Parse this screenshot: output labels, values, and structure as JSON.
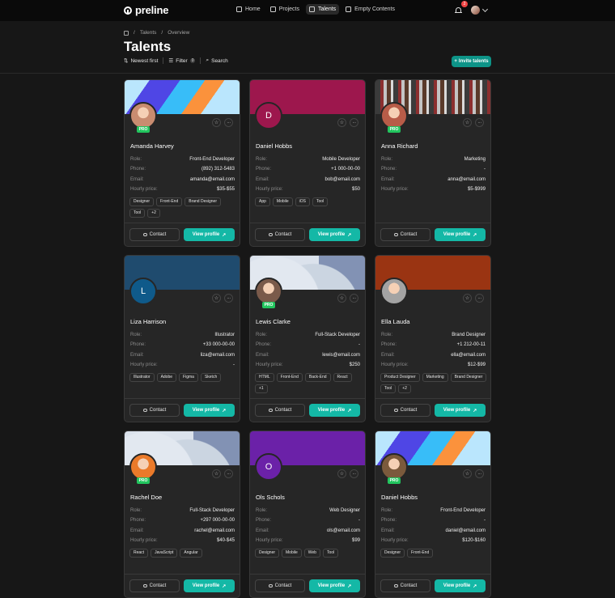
{
  "brand": {
    "name": "preline"
  },
  "nav": [
    {
      "label": "Home",
      "icon": "home-icon",
      "active": false
    },
    {
      "label": "Projects",
      "icon": "briefcase-icon",
      "active": false
    },
    {
      "label": "Talents",
      "icon": "users-icon",
      "active": true
    },
    {
      "label": "Empty Contents",
      "icon": "document-icon",
      "active": false
    }
  ],
  "notifications": {
    "count": "2"
  },
  "breadcrumb": {
    "home_icon": "home-icon",
    "items": [
      "Talents",
      "Overview"
    ]
  },
  "page": {
    "title": "Talents"
  },
  "toolbar": {
    "sort": "Newest first",
    "filter": "Filter",
    "filter_count": "0",
    "search": "Search",
    "invite": "Invite talents"
  },
  "card_labels": {
    "role": "Role:",
    "phone": "Phone:",
    "email": "Email:",
    "price": "Hourly price:",
    "contact": "Contact",
    "view": "View profile",
    "pro": "PRO"
  },
  "colors": {
    "accent": "#14b8a6",
    "pro": "#22c55e",
    "badge": "#ef4444"
  },
  "talents": [
    {
      "name": "Amanda Harvey",
      "role": "Front-End Developer",
      "phone": "(892) 312-5483",
      "email": "amanda@email.com",
      "price": "$35-$55",
      "tags": [
        "Designer",
        "Front-End",
        "Brand Designer",
        "Tool",
        "+2"
      ],
      "pro": true,
      "initial": "",
      "cover": "stripes",
      "avatar_color": "#c98c70"
    },
    {
      "name": "Daniel Hobbs",
      "role": "Mobile Developer",
      "phone": "+1 000-00-00",
      "email": "bob@email.com",
      "price": "$50",
      "tags": [
        "App",
        "Mobile",
        "iOS",
        "Tool"
      ],
      "pro": false,
      "initial": "D",
      "cover": "#9d174d",
      "avatar_color": "#9d174d"
    },
    {
      "name": "Anna Richard",
      "role": "Marketing",
      "phone": "-",
      "email": "anna@email.com",
      "price": "$5-$999",
      "tags": [],
      "pro": true,
      "initial": "",
      "cover": "city",
      "avatar_color": "#b85c48"
    },
    {
      "name": "Liza Harrison",
      "role": "Illustrator",
      "phone": "+33 000-00-00",
      "email": "liza@email.com",
      "price": "-",
      "tags": [
        "Illustrator",
        "Adobe",
        "Figma",
        "Sketch"
      ],
      "pro": false,
      "initial": "L",
      "cover": "#1f4b6e",
      "avatar_color": "#0f5a8a"
    },
    {
      "name": "Lewis Clarke",
      "role": "Full-Stack Developer",
      "phone": "-",
      "email": "lewis@email.com",
      "price": "$250",
      "tags": [
        "HTML",
        "Front-End",
        "Back-End",
        "React",
        "+1"
      ],
      "pro": true,
      "initial": "",
      "cover": "waves",
      "avatar_color": "#7a5a4a"
    },
    {
      "name": "Ella Lauda",
      "role": "Brand Designer",
      "phone": "+1 212-00-11",
      "email": "ella@email.com",
      "price": "$12-$99",
      "tags": [
        "Product Designer",
        "Marketing",
        "Brand Designer",
        "Tool",
        "+2"
      ],
      "pro": false,
      "initial": "",
      "cover": "#9a3412",
      "avatar_color": "#a3a3a3"
    },
    {
      "name": "Rachel Doe",
      "role": "Full-Stack Developer",
      "phone": "+297 000-00-00",
      "email": "rachel@email.com",
      "price": "$40-$45",
      "tags": [
        "React",
        "JavaScript",
        "Angular"
      ],
      "pro": true,
      "initial": "",
      "cover": "waves",
      "avatar_color": "#ea7a2a"
    },
    {
      "name": "Ols Schols",
      "role": "Web Designer",
      "phone": "-",
      "email": "ols@email.com",
      "price": "$99",
      "tags": [
        "Designer",
        "Mobile",
        "Web",
        "Tool"
      ],
      "pro": false,
      "initial": "O",
      "cover": "#6b21a8",
      "avatar_color": "#6b21a8"
    },
    {
      "name": "Daniel Hobbs",
      "role": "Front-End Developer",
      "phone": "-",
      "email": "daniel@email.com",
      "price": "$120-$160",
      "tags": [
        "Designer",
        "Front-End"
      ],
      "pro": true,
      "initial": "",
      "cover": "stripes",
      "avatar_color": "#7b5a3c"
    }
  ]
}
